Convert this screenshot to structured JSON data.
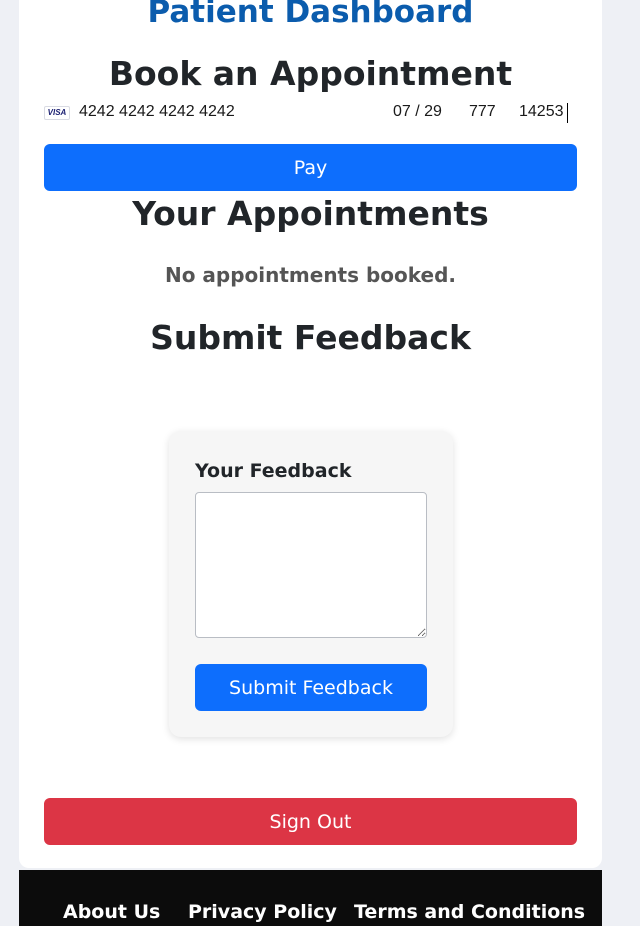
{
  "header": {
    "title": "Patient Dashboard"
  },
  "booking": {
    "title": "Book an Appointment",
    "card": {
      "brand_icon": "visa-icon",
      "brand_label": "VISA",
      "number": "4242 4242 4242 4242",
      "expiry": "07 / 29",
      "cvc": "777",
      "zip": "14253"
    },
    "pay_label": "Pay"
  },
  "appointments": {
    "title": "Your Appointments",
    "empty_text": "No appointments booked."
  },
  "feedback": {
    "title": "Submit Feedback",
    "label": "Your Feedback",
    "value": "",
    "submit_label": "Submit Feedback"
  },
  "signout": {
    "label": "Sign Out"
  },
  "footer": {
    "links": [
      "About Us",
      "Privacy Policy",
      "Terms and Conditions"
    ]
  },
  "colors": {
    "primary": "#0d6efd",
    "danger": "#dc3545",
    "title_blue": "#0b5cad",
    "footer_bg": "#0c0c0c"
  }
}
